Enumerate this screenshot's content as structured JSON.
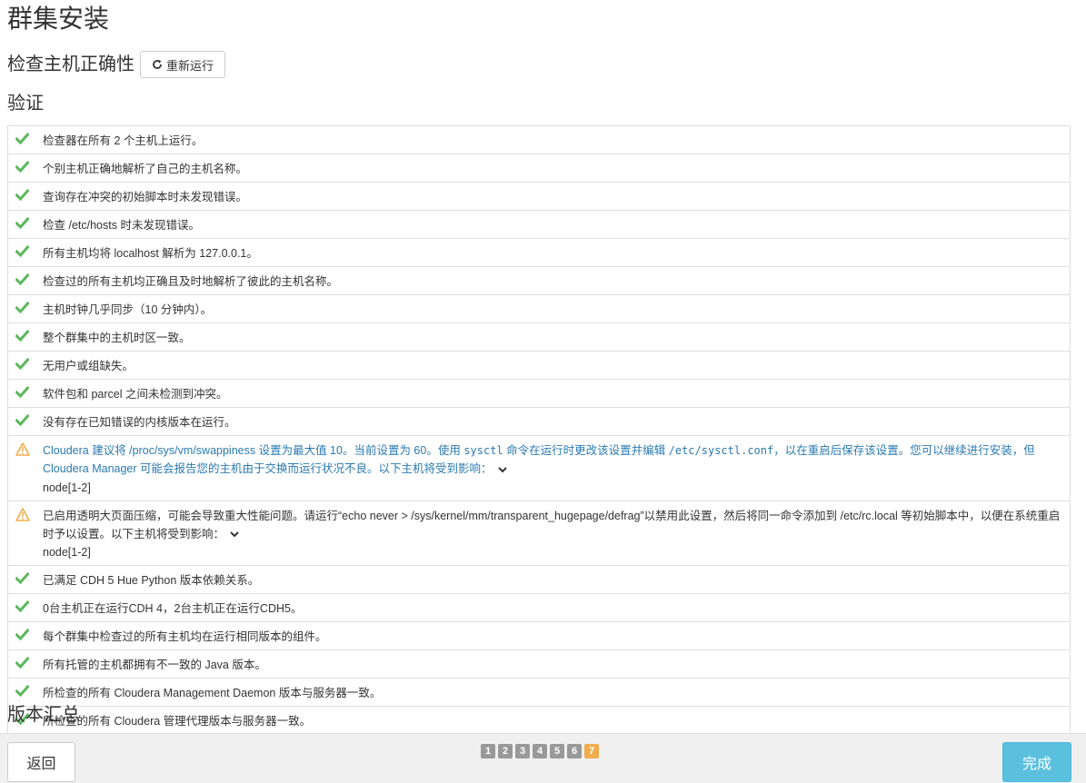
{
  "page": {
    "title": "群集安装"
  },
  "check": {
    "heading": "检查主机正确性",
    "rerun_label": "重新运行"
  },
  "verify": {
    "title": "验证"
  },
  "rows": [
    {
      "status": "ok",
      "text": "检查器在所有 2 个主机上运行。"
    },
    {
      "status": "ok",
      "text": "个别主机正确地解析了自己的主机名称。"
    },
    {
      "status": "ok",
      "text": "查询存在冲突的初始脚本时未发现错误。"
    },
    {
      "status": "ok",
      "text": "检查 /etc/hosts 时未发现错误。"
    },
    {
      "status": "ok",
      "text": "所有主机均将 localhost 解析为 127.0.0.1。"
    },
    {
      "status": "ok",
      "text": "检查过的所有主机均正确且及时地解析了彼此的主机名称。"
    },
    {
      "status": "ok",
      "text": "主机时钟几乎同步（10 分钟内）。"
    },
    {
      "status": "ok",
      "text": "整个群集中的主机时区一致。"
    },
    {
      "status": "ok",
      "text": "无用户或组缺失。"
    },
    {
      "status": "ok",
      "text": "软件包和 parcel 之间未检测到冲突。"
    },
    {
      "status": "ok",
      "text": "没有存在已知错误的内核版本在运行。"
    }
  ],
  "warn1": {
    "part1": "Cloudera 建议将 /proc/sys/vm/swappiness 设置为最大值 10。当前设置为 60。使用 ",
    "code1": "sysctl",
    "part2": " 命令在运行时更改该设置并编辑 ",
    "code2": "/etc/sysctl.conf",
    "part3": "，以在重启后保存该设置。您可以继续进行安装，但 Cloudera Manager 可能会报告您的主机由于交换而运行状况不良。以下主机将受到影响：",
    "hosts": "node[1-2]"
  },
  "warn2": {
    "text": "已启用透明大页面压缩，可能会导致重大性能问题。请运行“echo never > /sys/kernel/mm/transparent_hugepage/defrag”以禁用此设置，然后将同一命令添加到 /etc/rc.local 等初始脚本中，以便在系统重启时予以设置。以下主机将受到影响：",
    "hosts": "node[1-2]"
  },
  "rows2": [
    {
      "status": "ok",
      "text": "已满足 CDH 5 Hue Python 版本依赖关系。"
    },
    {
      "status": "ok",
      "text": "0台主机正在运行CDH 4，2台主机正在运行CDH5。"
    },
    {
      "status": "ok",
      "text": "每个群集中检查过的所有主机均在运行相同版本的组件。"
    },
    {
      "status": "ok",
      "text": "所有托管的主机都拥有不一致的 Java 版本。"
    },
    {
      "status": "ok",
      "text": "所检查的所有 Cloudera Management Daemon 版本与服务器一致。"
    },
    {
      "status": "ok",
      "text": "所检查的所有 Cloudera 管理代理版本与服务器一致。"
    }
  ],
  "summary": {
    "title": "版本汇总"
  },
  "footer": {
    "back_label": "返回",
    "finish_label": "完成",
    "steps": [
      "1",
      "2",
      "3",
      "4",
      "5",
      "6",
      "7"
    ],
    "active_step": "7"
  },
  "colors": {
    "ok": "#5cb85c",
    "warn": "#f0ad4e",
    "link": "#2a7ab0",
    "primary": "#5bc0de"
  },
  "icons": {
    "ok": "check-icon",
    "warn": "warning-icon",
    "rerun": "refresh-icon",
    "expand": "chevron-down-icon"
  }
}
